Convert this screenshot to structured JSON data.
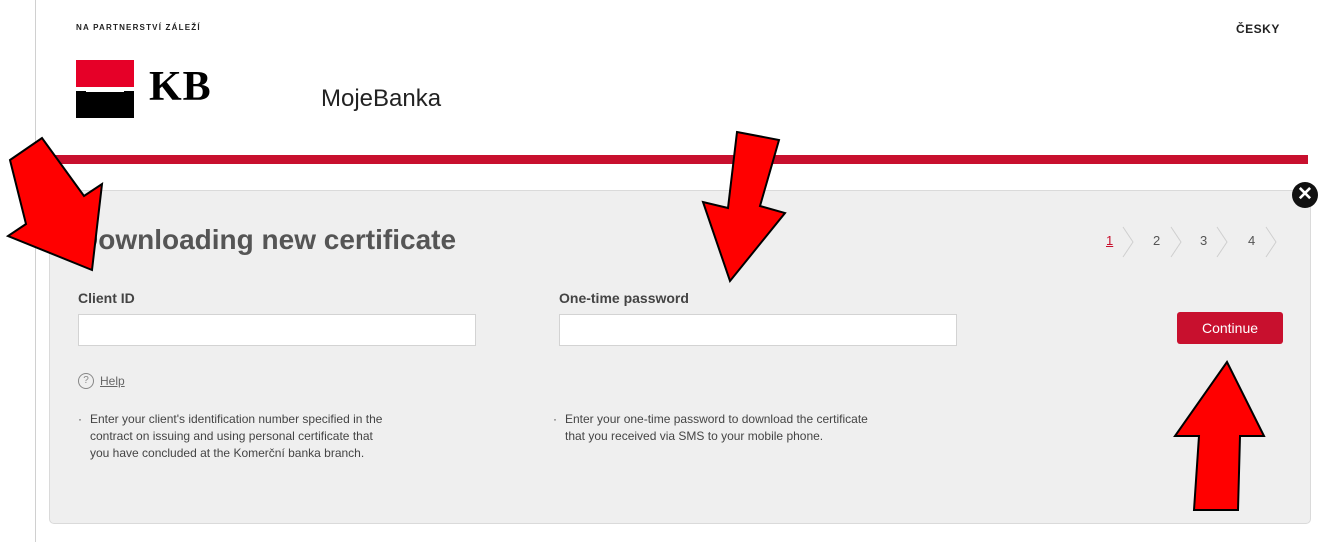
{
  "header": {
    "slogan": "NA PARTNERSTVÍ ZÁLEŽÍ",
    "language_link": "ČESKY",
    "logo_text": "KB",
    "app_name": "MojeBanka"
  },
  "dialog": {
    "title": "Downloading new certificate",
    "close_icon": "close-icon",
    "steps": {
      "current": "1",
      "items": [
        "1",
        "2",
        "3",
        "4"
      ]
    },
    "client_id": {
      "label": "Client ID",
      "value": "",
      "placeholder": ""
    },
    "otp": {
      "label": "One-time password",
      "value": "",
      "placeholder": ""
    },
    "continue_label": "Continue",
    "help_label": "Help",
    "client_note": "Enter your client's identification number specified in the contract on issuing and using personal certificate that you have concluded at the Komerční banka branch.",
    "otp_note": "Enter your one-time password to download the certificate that you received via SMS to your mobile phone."
  },
  "colors": {
    "brand_red": "#c8102e",
    "logo_red": "#e60028",
    "annotation_red": "#ff0000"
  }
}
